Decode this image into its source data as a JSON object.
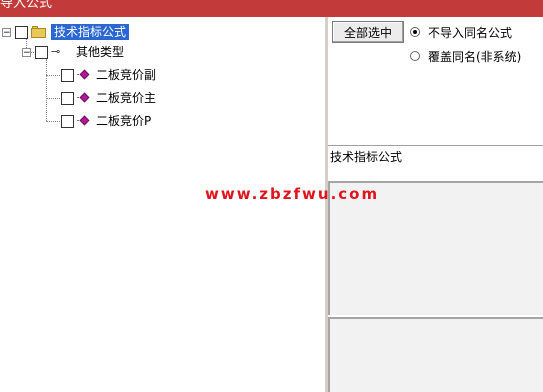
{
  "window": {
    "title": "导入公式"
  },
  "tree": {
    "root": {
      "label": "技术指标公式",
      "expander": "−"
    },
    "category": {
      "label": "其他类型",
      "expander": "−"
    },
    "items": [
      {
        "label": "二板竞价副"
      },
      {
        "label": "二板竞价主"
      },
      {
        "label": "二板竞价P"
      }
    ]
  },
  "options": {
    "select_all_label": "全部选中",
    "radios": [
      {
        "label": "不导入同名公式",
        "checked": true
      },
      {
        "label": "覆盖同名(非系统)",
        "checked": false
      }
    ]
  },
  "detail": {
    "section_label": "技术指标公式"
  },
  "watermark": "www.zbzfwu.com",
  "colors": {
    "title_bar": "#c23a3a",
    "selection": "#2b67d3",
    "watermark": "#e0141e"
  }
}
